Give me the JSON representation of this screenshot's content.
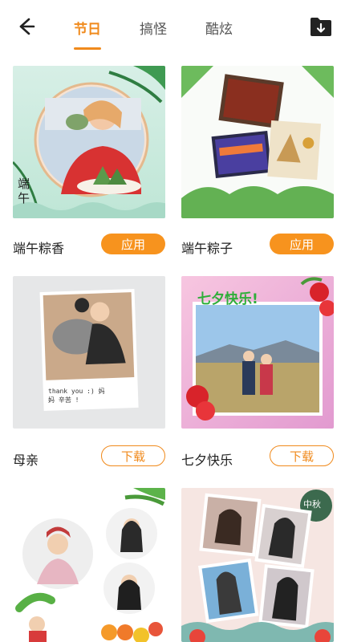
{
  "header": {
    "tabs": [
      {
        "label": "节日",
        "active": true
      },
      {
        "label": "搞怪",
        "active": false
      },
      {
        "label": "酷炫",
        "active": false
      }
    ],
    "accent_color": "#f08a1c",
    "icons": {
      "back": "arrow-left-icon",
      "action": "folder-download-icon"
    }
  },
  "templates": [
    {
      "title": "端午粽香",
      "action": "应用",
      "state": "downloaded",
      "thumb_text": "端午"
    },
    {
      "title": "端午粽子",
      "action": "应用",
      "state": "downloaded"
    },
    {
      "title": "母亲",
      "action": "下载",
      "state": "not-downloaded",
      "thumb_text": "thank you :) 妈妈 辛苦 !"
    },
    {
      "title": "七夕快乐",
      "action": "下载",
      "state": "not-downloaded",
      "thumb_text": "七夕快乐!"
    },
    {
      "title": "",
      "action": "",
      "state": "partial"
    },
    {
      "title": "",
      "action": "",
      "state": "partial",
      "thumb_text": "中秋"
    }
  ]
}
